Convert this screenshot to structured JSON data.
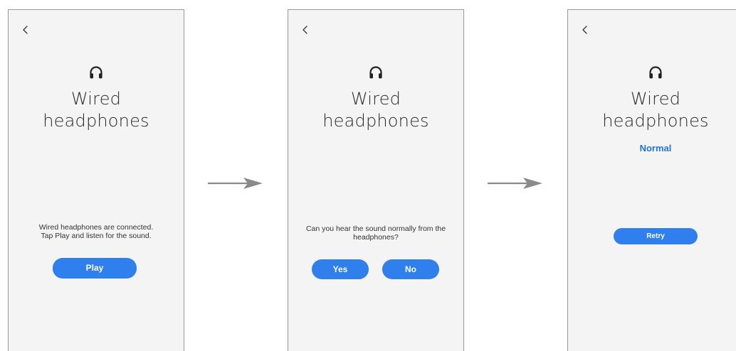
{
  "colors": {
    "screen_background": "#f4f4f4",
    "accent": "#2f80ed",
    "status_text": "#1f74e3",
    "arrow": "#8a8a8a"
  },
  "screens": [
    {
      "back_icon": "chevron-left-icon",
      "icon": "headphones-icon",
      "title_line1": "Wired",
      "title_line2": "headphones",
      "message_line1": "Wired headphones are connected.",
      "message_line2": "Tap Play and listen for the sound.",
      "buttons": {
        "play": "Play"
      }
    },
    {
      "back_icon": "chevron-left-icon",
      "icon": "headphones-icon",
      "title_line1": "Wired",
      "title_line2": "headphones",
      "message_line1": "Can you hear the sound normally from the",
      "message_line2": "headphones?",
      "buttons": {
        "yes": "Yes",
        "no": "No"
      }
    },
    {
      "back_icon": "chevron-left-icon",
      "icon": "headphones-icon",
      "title_line1": "Wired",
      "title_line2": "headphones",
      "status": "Normal",
      "buttons": {
        "retry": "Retry"
      }
    }
  ],
  "flow_arrow_icon": "right-arrow-icon"
}
